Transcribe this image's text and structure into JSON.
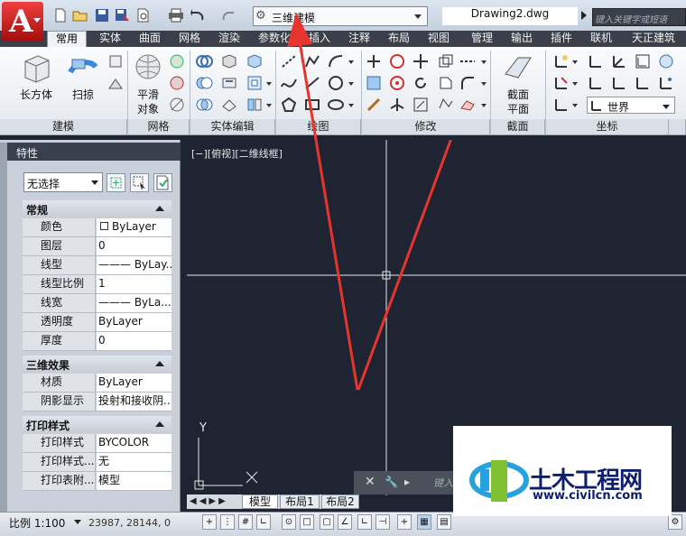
{
  "app": {
    "logo_letter": "A",
    "workspace": "三维建模",
    "document_title": "Drawing2.dwg",
    "search_placeholder": "键入关键字或短语"
  },
  "tabs": [
    "常用",
    "实体",
    "曲面",
    "网格",
    "渲染",
    "参数化",
    "插入",
    "注释",
    "布局",
    "视图",
    "管理",
    "输出",
    "插件",
    "联机",
    "天正建筑"
  ],
  "ribbon": {
    "modeling": {
      "box_label": "长方体",
      "sweep_label": "扫掠",
      "title": "建模"
    },
    "mesh": {
      "smooth_label_1": "平滑",
      "smooth_label_2": "对象",
      "title": "网格"
    },
    "solid_edit": {
      "title": "实体编辑"
    },
    "draw": {
      "title": "绘图"
    },
    "modify": {
      "title": "修改"
    },
    "section": {
      "label_1": "截面",
      "label_2": "平面",
      "title": "截面"
    },
    "coordinates": {
      "world": "世界",
      "title": "坐标"
    }
  },
  "palette": {
    "title": "特性",
    "selection": "无选择",
    "sections": [
      {
        "name": "常规",
        "rows": [
          {
            "label": "颜色",
            "value": "ByLayer",
            "swatch": true
          },
          {
            "label": "图层",
            "value": "0"
          },
          {
            "label": "线型",
            "value": "——— ByLay..."
          },
          {
            "label": "线型比例",
            "value": "1"
          },
          {
            "label": "线宽",
            "value": "——— ByLa..."
          },
          {
            "label": "透明度",
            "value": "ByLayer"
          },
          {
            "label": "厚度",
            "value": "0"
          }
        ]
      },
      {
        "name": "三维效果",
        "rows": [
          {
            "label": "材质",
            "value": "ByLayer"
          },
          {
            "label": "阴影显示",
            "value": "投射和接收阴..."
          }
        ]
      },
      {
        "name": "打印样式",
        "rows": [
          {
            "label": "打印样式",
            "value": "BYCOLOR"
          },
          {
            "label": "打印样式...",
            "value": "无"
          },
          {
            "label": "打印表附...",
            "value": "模型"
          }
        ]
      }
    ]
  },
  "viewport": {
    "label": "[−][俯视][二维线框]",
    "axis_y": "Y"
  },
  "layout_tabs": [
    "模型",
    "布局1",
    "布局2"
  ],
  "command": {
    "placeholder": "键入"
  },
  "status": {
    "scale": "比例 1:100",
    "coords": "23987, 28144, 0"
  },
  "watermark": {
    "title": "土木工程网",
    "url": "www.civilcn.com"
  },
  "colors": {
    "canvas": "#1e2431",
    "annotation_arrow": "#e8342e",
    "tab_bar": "#3a3f4a"
  }
}
